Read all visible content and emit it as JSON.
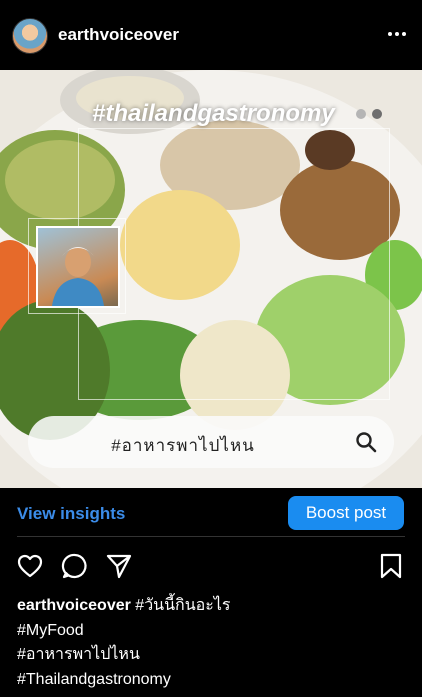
{
  "post": {
    "username": "earthvoiceover",
    "overlay_hashtag": "#thailandgastronomy",
    "search_text": "#อาหารพาไปไหน"
  },
  "insights": {
    "view_insights": "View insights",
    "boost_post": "Boost post"
  },
  "caption": {
    "username": "earthvoiceover",
    "line1": "#วันนี้กินอะไร",
    "line2": "#MyFood",
    "line3": "#อาหารพาไปไหน",
    "line4": "#Thailandgastronomy"
  },
  "colors": {
    "background": "#000000",
    "link_blue": "#3b8ce8",
    "boost_blue": "#1a8cf0"
  },
  "icons": [
    "more-horizontal-icon",
    "heart-icon",
    "comment-icon",
    "share-icon",
    "bookmark-icon",
    "search-icon"
  ]
}
